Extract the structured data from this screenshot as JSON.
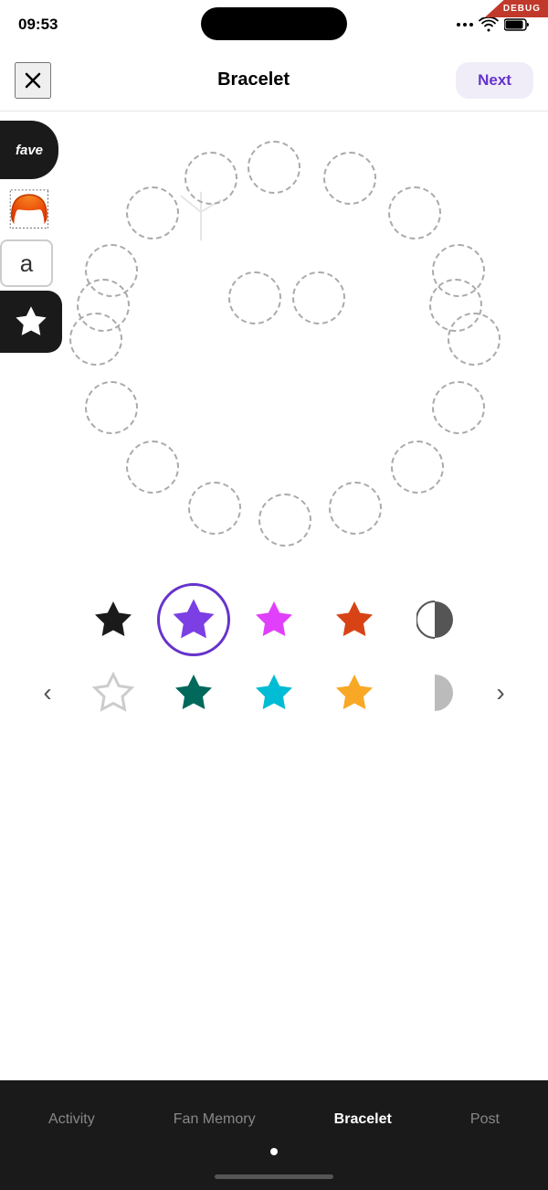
{
  "debug": {
    "label": "DEBUG"
  },
  "status": {
    "time": "09:53",
    "icons": [
      "...",
      "wifi",
      "battery"
    ]
  },
  "header": {
    "close_label": "×",
    "title": "Bracelet",
    "next_label": "Next"
  },
  "sidebar": {
    "tools": [
      {
        "id": "fave",
        "label": "fave",
        "type": "text"
      },
      {
        "id": "hair",
        "label": "🦰",
        "type": "emoji"
      },
      {
        "id": "text",
        "label": "a",
        "type": "text"
      },
      {
        "id": "star",
        "label": "★",
        "type": "star"
      }
    ]
  },
  "bracelet": {
    "beads": 20
  },
  "colors": {
    "row1": [
      {
        "id": "black",
        "color": "#1a1a1a",
        "selected": false
      },
      {
        "id": "purple",
        "color": "#7b3fe4",
        "selected": true
      },
      {
        "id": "pink",
        "color": "#e040fb",
        "selected": false
      },
      {
        "id": "red",
        "color": "#d84315",
        "selected": false
      },
      {
        "id": "halfmoon",
        "color": "#888",
        "selected": false,
        "type": "halfmoon"
      }
    ],
    "row2": [
      {
        "id": "white",
        "color": "#e8e8e8",
        "selected": false
      },
      {
        "id": "green",
        "color": "#00695c",
        "selected": false
      },
      {
        "id": "cyan",
        "color": "#00bcd4",
        "selected": false
      },
      {
        "id": "yellow",
        "color": "#f9a825",
        "selected": false
      },
      {
        "id": "halfmoon2",
        "color": "#ccc",
        "selected": false,
        "type": "halfmoon"
      }
    ]
  },
  "bottom_nav": {
    "items": [
      {
        "id": "activity",
        "label": "Activity",
        "active": false
      },
      {
        "id": "fan-memory",
        "label": "Fan Memory",
        "active": false
      },
      {
        "id": "bracelet",
        "label": "Bracelet",
        "active": true
      },
      {
        "id": "post",
        "label": "Post",
        "active": false
      }
    ]
  }
}
